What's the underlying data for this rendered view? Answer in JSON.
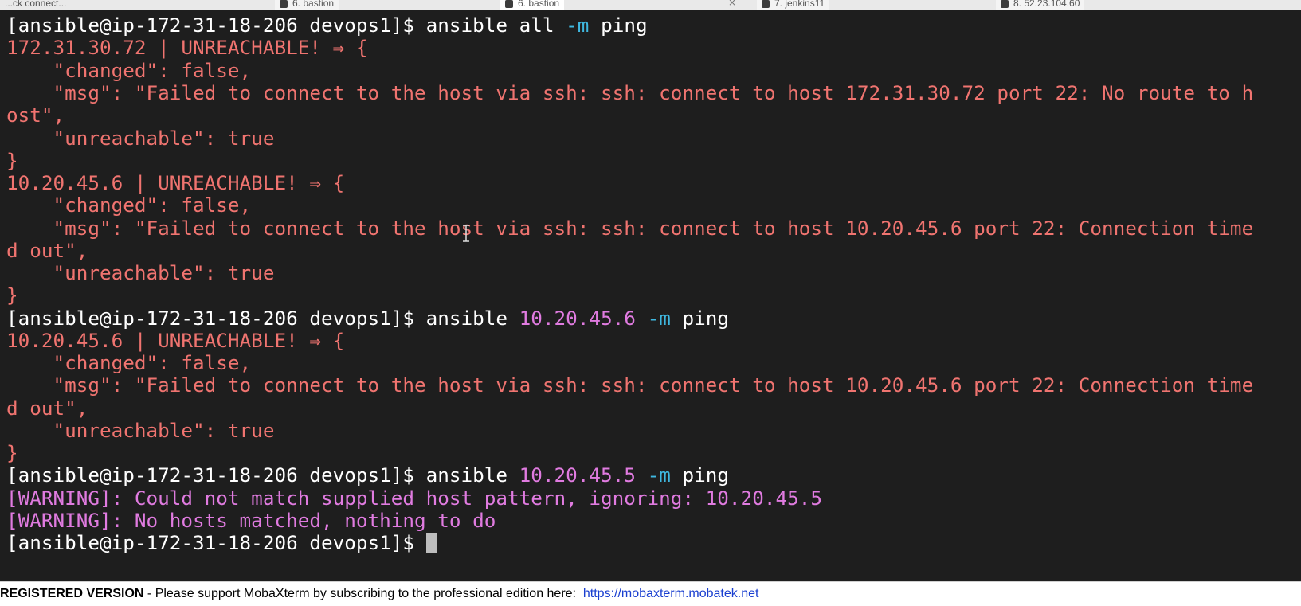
{
  "browser_tabs": [
    {
      "label": "...ck connect..."
    },
    {
      "label": "6. bastion"
    },
    {
      "label": "6. bastion"
    },
    {
      "label": "7. jenkins11"
    },
    {
      "label": "8. 52.23.104.60"
    }
  ],
  "terminal": {
    "prompt": "[ansible@ip-172-31-18-206 devops1]$ ",
    "lines": {
      "l1_cmd": "ansible all",
      "l1_flag": "-m",
      "l1_mod": "ping",
      "l2": "172.31.30.72 | UNREACHABLE! ⇒ {",
      "l3": "    \"changed\": false,",
      "l4": "    \"msg\": \"Failed to connect to the host via ssh: ssh: connect to host 172.31.30.72 port 22: No route to h",
      "l5": "ost\",",
      "l6": "    \"unreachable\": true",
      "l7": "}",
      "l8": "10.20.45.6 | UNREACHABLE! ⇒ {",
      "l9": "    \"changed\": false,",
      "l10": "    \"msg\": \"Failed to connect to the host via ssh: ssh: connect to host 10.20.45.6 port 22: Connection time",
      "l11": "d out\",",
      "l12": "    \"unreachable\": true",
      "l13": "}",
      "l14_cmd": "ansible",
      "l14_host": "10.20.45.6",
      "l14_flag": "-m",
      "l14_mod": "ping",
      "l15": "10.20.45.6 | UNREACHABLE! ⇒ {",
      "l16": "    \"changed\": false,",
      "l17": "    \"msg\": \"Failed to connect to the host via ssh: ssh: connect to host 10.20.45.6 port 22: Connection time",
      "l18": "d out\",",
      "l19": "    \"unreachable\": true",
      "l20": "}",
      "l21_cmd": "ansible",
      "l21_host": "10.20.45.5",
      "l21_flag": "-m",
      "l21_mod": "ping",
      "l22": "[WARNING]: Could not match supplied host pattern, ignoring: 10.20.45.5",
      "l23": "[WARNING]: No hosts matched, nothing to do"
    }
  },
  "statusbar": {
    "registered": "REGISTERED VERSION",
    "separator": " - ",
    "message": "Please support MobaXterm by subscribing to the professional edition here:",
    "link": "https://mobaxterm.mobatek.net"
  },
  "colors": {
    "terminal_bg": "#1e1e1e",
    "error": "#f07470",
    "warning": "#e07be0",
    "flag": "#3fb8e0"
  }
}
